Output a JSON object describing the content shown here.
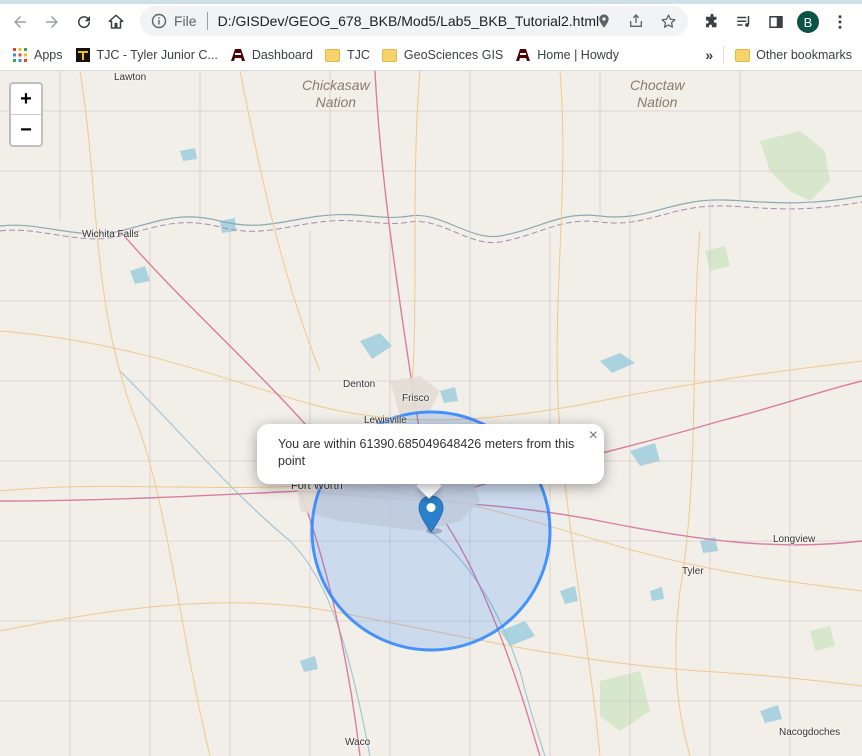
{
  "browser": {
    "file_label": "File",
    "url": "D:/GISDev/GEOG_678_BKB/Mod5/Lab5_BKB_Tutorial2.html",
    "avatar_letter": "B"
  },
  "bookmarks": {
    "items": [
      {
        "label": "Apps",
        "icon": "apps-grid-icon"
      },
      {
        "label": "TJC - Tyler Junior C...",
        "icon": "tjc-logo-icon"
      },
      {
        "label": "Dashboard",
        "icon": "tamu-logo-icon"
      },
      {
        "label": "TJC",
        "icon": "folder-icon"
      },
      {
        "label": "GeoSciences GIS",
        "icon": "folder-icon"
      },
      {
        "label": "Home | Howdy",
        "icon": "tamu-logo-icon"
      }
    ],
    "overflow": "»",
    "other": "Other bookmarks"
  },
  "map": {
    "zoom_in": "+",
    "zoom_out": "−",
    "nations": [
      "Chickasaw Nation",
      "Choctaw Nation"
    ],
    "places": [
      "Lawton",
      "Wichita Falls",
      "Denton",
      "Frisco",
      "Lewisville",
      "Fort Worth",
      "Longview",
      "Tyler",
      "Waco",
      "Nacogdoches"
    ],
    "popup": {
      "text": "You are within 61390.685049648426 meters from this point",
      "close": "×"
    },
    "colors": {
      "circle_stroke": "#3388ff",
      "circle_fill": "#3388ff",
      "marker": "#2a81cb",
      "water": "#aad3df",
      "background": "#f2efe9"
    }
  }
}
